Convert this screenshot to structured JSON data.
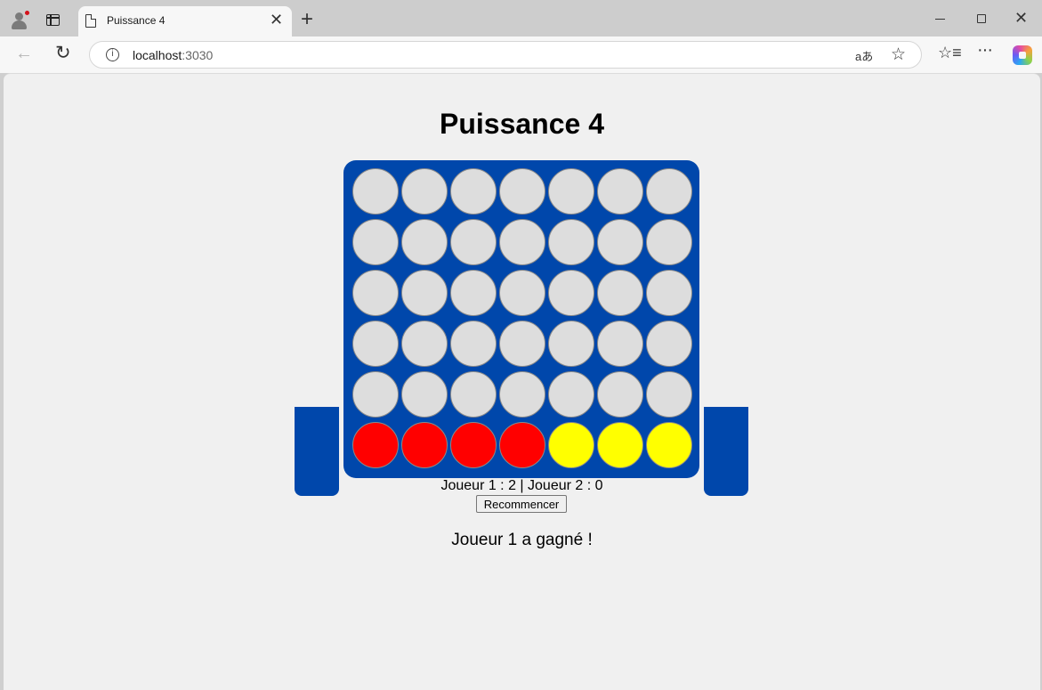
{
  "browser": {
    "tab_title": "Puissance 4",
    "url_host": "localhost",
    "url_port": ":3030"
  },
  "icons": {
    "back": "←",
    "reload": "↻",
    "close": "✕",
    "new_tab": "+",
    "favorite": "☆",
    "read_aloud": "aあ",
    "more": "···",
    "window_close": "✕"
  },
  "game": {
    "title": "Puissance 4",
    "score": "Joueur 1 : 2 | Joueur 2 : 0",
    "restart_label": "Recommencer",
    "status": "Joueur 1 a gagné !",
    "board": [
      [
        "empty",
        "empty",
        "empty",
        "empty",
        "empty",
        "empty",
        "empty"
      ],
      [
        "empty",
        "empty",
        "empty",
        "empty",
        "empty",
        "empty",
        "empty"
      ],
      [
        "empty",
        "empty",
        "empty",
        "empty",
        "empty",
        "empty",
        "empty"
      ],
      [
        "empty",
        "empty",
        "empty",
        "empty",
        "empty",
        "empty",
        "empty"
      ],
      [
        "empty",
        "empty",
        "empty",
        "empty",
        "empty",
        "empty",
        "empty"
      ],
      [
        "red",
        "red",
        "red",
        "red",
        "yellow",
        "yellow",
        "yellow"
      ]
    ],
    "colors": {
      "board": "#0047ab",
      "empty": "#dddddd",
      "red": "#ff0000",
      "yellow": "#ffff00"
    }
  }
}
